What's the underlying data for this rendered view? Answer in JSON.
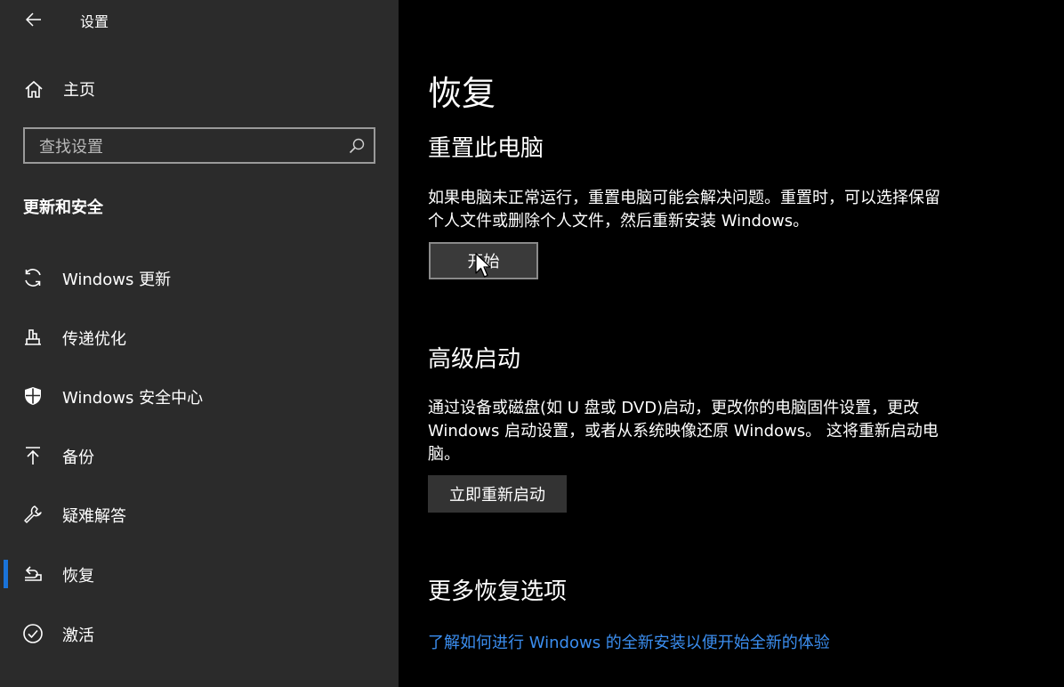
{
  "window": {
    "title": "设置"
  },
  "sidebar": {
    "home_label": "主页",
    "search_placeholder": "查找设置",
    "section_heading": "更新和安全",
    "items": [
      {
        "label": "Windows 更新",
        "icon": "sync-icon"
      },
      {
        "label": "传递优化",
        "icon": "delivery-optimization-icon"
      },
      {
        "label": "Windows 安全中心",
        "icon": "shield-icon"
      },
      {
        "label": "备份",
        "icon": "backup-arrow-icon"
      },
      {
        "label": "疑难解答",
        "icon": "wrench-icon"
      },
      {
        "label": "恢复",
        "icon": "recovery-icon",
        "active": true
      },
      {
        "label": "激活",
        "icon": "check-circle-icon"
      }
    ]
  },
  "main": {
    "title": "恢复",
    "reset": {
      "heading": "重置此电脑",
      "desc_line1": "如果电脑未正常运行，重置电脑可能会解决问题。重置时，可以选择保留",
      "desc_line2": "个人文件或删除个人文件，然后重新安装 Windows。",
      "button": "开始"
    },
    "advanced": {
      "heading": "高级启动",
      "desc_line1": "通过设备或磁盘(如 U 盘或 DVD)启动，更改你的电脑固件设置，更改",
      "desc_line2": "Windows 启动设置，或者从系统映像还原 Windows。 这将重新启动电",
      "desc_line3": "脑。",
      "button": "立即重新启动"
    },
    "more": {
      "heading": "更多恢复选项",
      "link": "了解如何进行 Windows 的全新安装以便开始全新的体验"
    }
  },
  "colors": {
    "sidebar_bg": "#2b2b2b",
    "main_bg": "#000000",
    "accent": "#1a73d9",
    "link": "#3b8ef0"
  }
}
